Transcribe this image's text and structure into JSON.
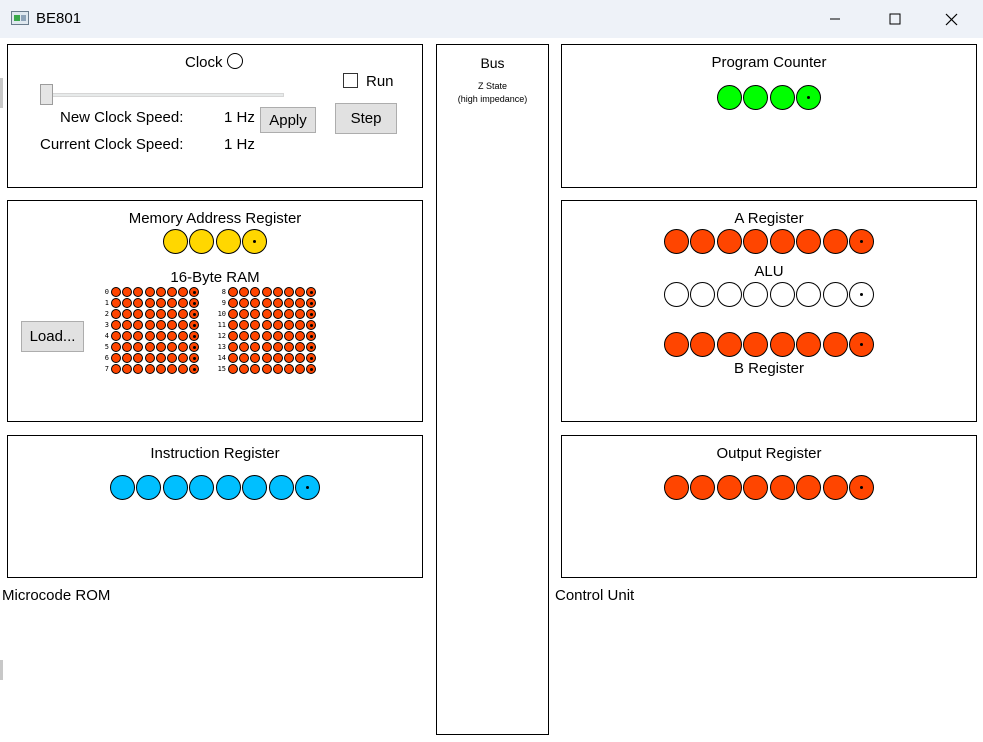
{
  "window": {
    "title": "BE801",
    "controls": {
      "minimize": "—",
      "maximize": "☐",
      "close": "✕"
    }
  },
  "clock": {
    "label": "Clock",
    "run_label": "Run",
    "run_checked": false,
    "step_label": "Step",
    "apply_label": "Apply",
    "new_speed_label": "New Clock Speed:",
    "new_speed_value": "1 Hz",
    "current_speed_label": "Current Clock Speed:",
    "current_speed_value": "1 Hz",
    "slider_level": 0
  },
  "bus": {
    "title": "Bus",
    "state_line1": "Z State",
    "state_line2": "(high impedance)"
  },
  "mar": {
    "title": "Memory Address Register",
    "bits": 4,
    "color": "#ffd700"
  },
  "ram": {
    "title": "16-Byte RAM",
    "load_label": "Load...",
    "row_labels": [
      "0",
      "1",
      "2",
      "3",
      "4",
      "5",
      "6",
      "7",
      "8",
      "9",
      "10",
      "11",
      "12",
      "13",
      "14",
      "15"
    ],
    "color": "#ff4500"
  },
  "ir": {
    "title": "Instruction Register",
    "bits": 8,
    "color": "#00bfff"
  },
  "pc": {
    "title": "Program Counter",
    "bits": 4,
    "color": "#00ff00"
  },
  "a_reg": {
    "title": "A Register",
    "bits": 8,
    "color": "#ff4500"
  },
  "alu": {
    "title": "ALU",
    "bits": 8,
    "color": "#ffffff"
  },
  "b_reg": {
    "title": "B Register",
    "bits": 8,
    "color": "#ff4500"
  },
  "out_reg": {
    "title": "Output Register",
    "bits": 8,
    "color": "#ff4500"
  },
  "labels": {
    "microcode_rom": "Microcode ROM",
    "control_unit": "Control Unit"
  }
}
